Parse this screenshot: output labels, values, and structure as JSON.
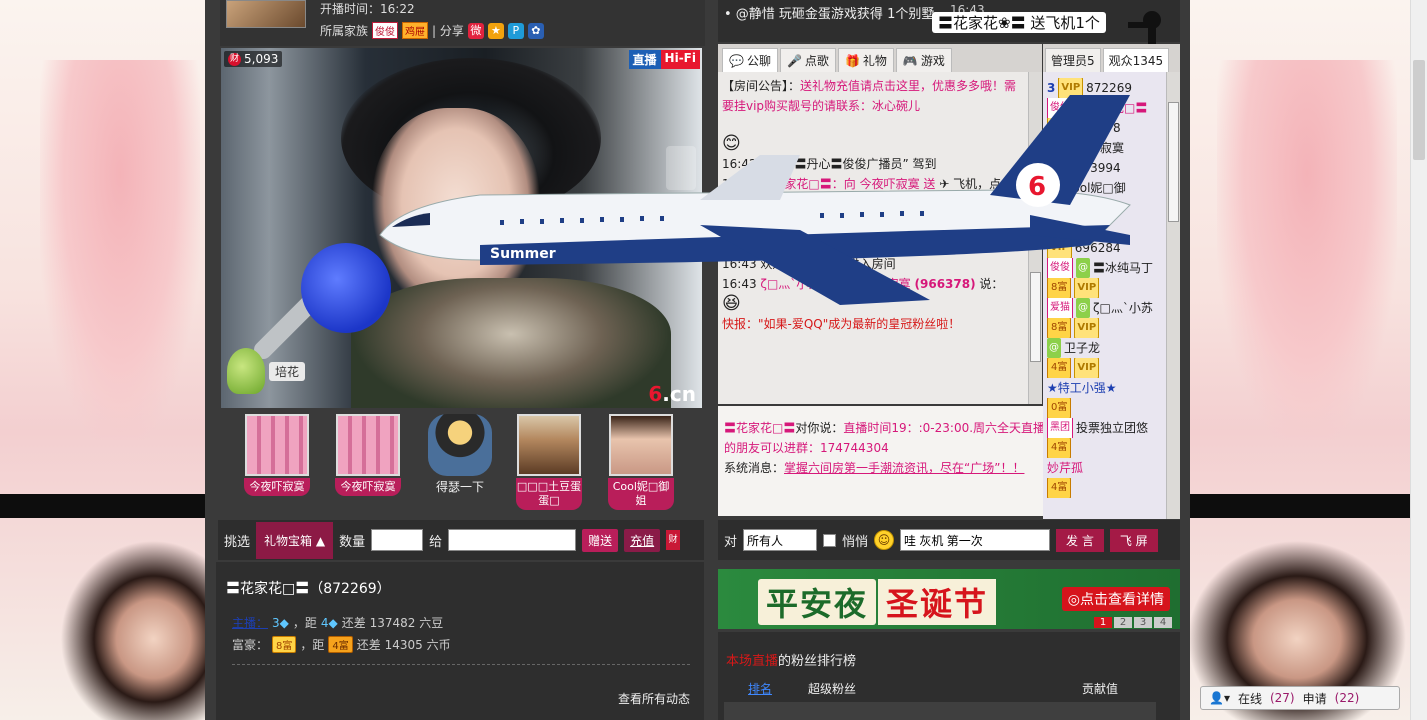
{
  "header": {
    "start_time": "开播时间：16:22",
    "family_label": "所属家族",
    "family_badge1": "俊俊",
    "family_badge2": "鸡屉",
    "share_label": "| 分享"
  },
  "video": {
    "coin_count": "5,093",
    "live_label": "直播",
    "hifi_label": "Hi-Fi",
    "plant_label": "培花",
    "logo": "6.cn"
  },
  "gifts": [
    {
      "label": "今夜吓寂寞"
    },
    {
      "label": "今夜吓寂寞"
    },
    {
      "label": "得瑟一下"
    },
    {
      "label": "□□□土豆蛋蛋□"
    },
    {
      "label": "Cool妮□御姐"
    }
  ],
  "gift_bar": {
    "pick_label": "挑选",
    "box_label": "礼物宝箱",
    "qty_label": "数量",
    "to_label": "给",
    "send_label": "赠送",
    "recharge_label": "充值",
    "coin_icon": "财"
  },
  "anchor": {
    "name": "〓花家花□〓（872269）",
    "host_row": "主播：",
    "host_dist": "，距",
    "host_gap": "还差 137482 六豆",
    "rich_row": "富豪：",
    "rich_lvl1": "8富",
    "rich_dist": "，距",
    "rich_lvl2": "4富",
    "rich_gap": "还差 14305 六币",
    "more": "查看所有动态"
  },
  "marquee": {
    "text": "• @静惜 玩砸金蛋游戏获得 1个别墅",
    "time": "16:43",
    "overlay": "〓花家花❀〓 送飞机1个"
  },
  "chat": {
    "tabs": [
      {
        "label": "公聊",
        "icon": "speech-bubble-icon"
      },
      {
        "label": "点歌",
        "icon": "mic-icon"
      },
      {
        "label": "礼物",
        "icon": "gift-icon"
      },
      {
        "label": "游戏",
        "icon": "gamepad-icon"
      }
    ],
    "notice_prefix": "【房间公告】：",
    "notice_body": "送礼物充值请点击这里，优惠多多哦！需要挂vip购买靓号的请联系：冰心碗儿",
    "msg1": "16:42 欢迎",
    "msg1_b": "“〓丹心〓俊俊广播员”",
    "msg1_c": "驾到",
    "msg2": "16:43",
    "msg2_b": "〓花家花□〓：向 今夜吓寂寞 送",
    "msg2_c": "飞机，点",
    "msg3": "说：砖转回来了",
    "msg4": "16:43 欢迎 “喜欢66♪”进入房间",
    "msg5a": "16:43",
    "msg5b": "ζ□灬`小苏☆ 对 今夜吓寂寞",
    "msg5c": "(966378)",
    "msg5d": "说：",
    "flash": "快报：\"如果-爱QQ\"成为最新的皇冠粉丝啦！"
  },
  "pm": {
    "from": "〓花家花□〓",
    "say": "对你说：",
    "body": "直播时间19：:0-23:00.周六全天直播。周日不播。喜欢聊天的朋友可以进群：174744304",
    "sys": "系统消息：",
    "sys_body": "掌握六间房第一手潮流资讯，尽在“广场”！！"
  },
  "users": {
    "tab_admin": "管理员5",
    "tab_audience": "观众1345",
    "rows": [
      {
        "badge": "3",
        "name": "872269"
      },
      {
        "badge": "俊俊",
        "name": "〓花家花□〓"
      },
      {
        "badge": "",
        "name": "966378"
      },
      {
        "badge": "",
        "name": "今夜吓寂寞"
      },
      {
        "badge": "VIP",
        "name": "963994"
      },
      {
        "badge": "",
        "name": "Cool妮□御"
      },
      {
        "badge": "VIP",
        "name": "61031"
      },
      {
        "badge": "",
        "name": "诺诺"
      },
      {
        "badge": "VIP",
        "name": "696284"
      },
      {
        "badge": "俊俊",
        "name": "〓冰纯马丁"
      },
      {
        "badge": "8富",
        "name": ""
      },
      {
        "badge": "爱猫",
        "name": "ζ□灬`小苏"
      },
      {
        "badge": "8富",
        "name": ""
      },
      {
        "badge": "",
        "name": "卫子龙"
      },
      {
        "badge": "4富",
        "name": ""
      },
      {
        "badge": "",
        "name": "★特工小强★"
      },
      {
        "badge": "0富",
        "name": ""
      },
      {
        "badge": "黑团",
        "name": "投票独立团悠"
      },
      {
        "badge": "4富",
        "name": ""
      },
      {
        "badge": "",
        "name": "妙芹孤"
      },
      {
        "badge": "4富",
        "name": ""
      }
    ]
  },
  "say_bar": {
    "to_label": "对",
    "target": "所有人",
    "whisper": "悄悄",
    "input": "哇 灰机 第一次",
    "send": "发 言",
    "fly": "飞 屏"
  },
  "banner": {
    "t1": "平安夜",
    "t2": "圣诞节",
    "cta": "◎点击查看详情",
    "pages": [
      "1",
      "2",
      "3",
      "4"
    ]
  },
  "fans": {
    "head_a": "本场直播",
    "head_b": "的粉丝排行榜",
    "col_rank": "排名",
    "col_super": "超级粉丝",
    "col_value": "贡献值"
  },
  "status": {
    "online_label": "在线",
    "online_count": "(27)",
    "apply_label": "申请",
    "apply_count": "(22)"
  }
}
